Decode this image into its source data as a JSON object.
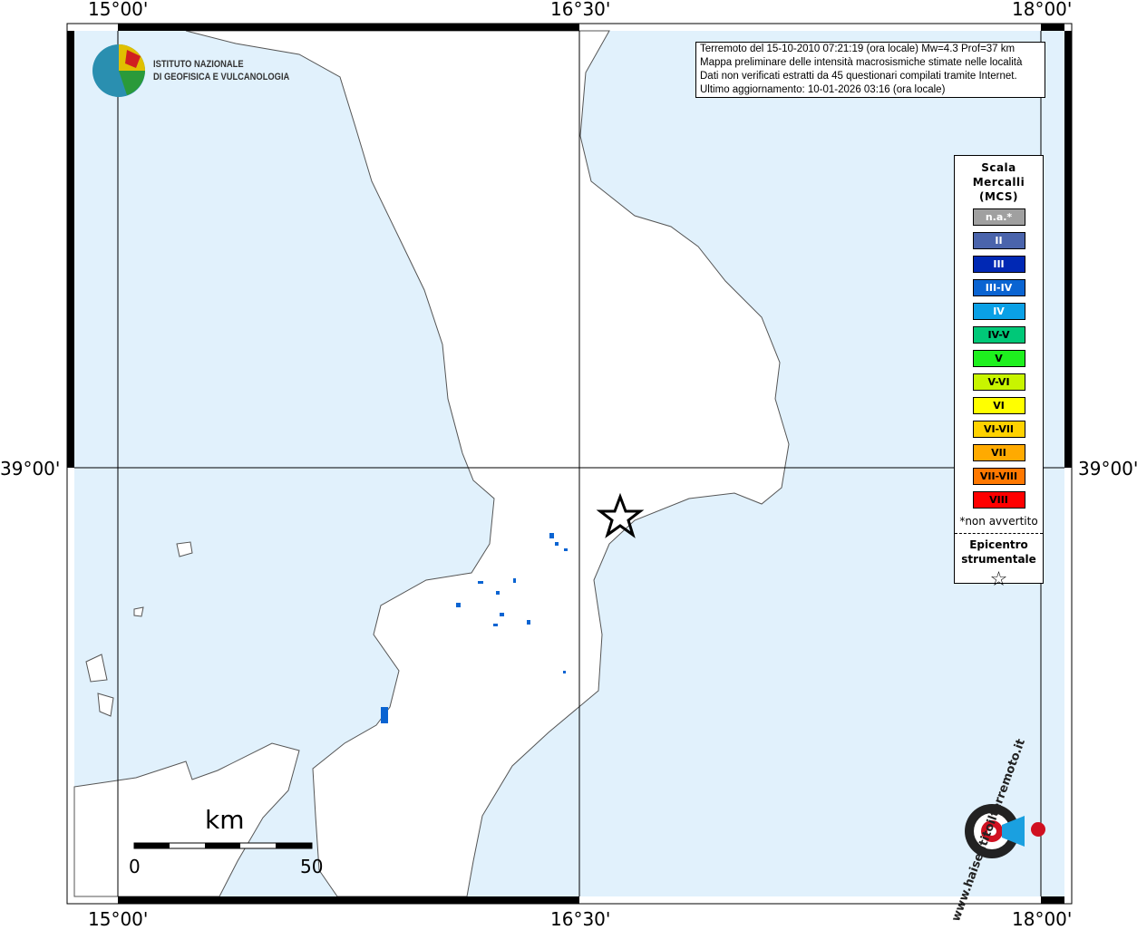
{
  "axes": {
    "lon_labels": [
      "15°00'",
      "16°30'",
      "18°00'"
    ],
    "lat_label": "39°00'"
  },
  "info_box": {
    "lines": [
      "Terremoto del 15-10-2010 07:21:19 (ora locale) Mw=4.3 Prof=37 km",
      "Mappa preliminare delle intensità macrosismiche stimate nelle località",
      "Dati non verificati estratti da 45 questionari compilati tramite Internet.",
      "Ultimo aggiornamento: 10-01-2026 03:16 (ora locale)"
    ]
  },
  "logo": {
    "line1": "ISTITUTO NAZIONALE",
    "line2": "DI GEOFISICA E VULCANOLOGIA"
  },
  "legend": {
    "title": [
      "Scala",
      "Mercalli",
      "(MCS)"
    ],
    "items": [
      {
        "label": "n.a.*",
        "color": "#a0a0a0",
        "text": "#ffffff"
      },
      {
        "label": "II",
        "color": "#4a64ac",
        "text": "#ffffff"
      },
      {
        "label": "III",
        "color": "#0028b4",
        "text": "#ffffff"
      },
      {
        "label": "III-IV",
        "color": "#0a64d2",
        "text": "#ffffff"
      },
      {
        "label": "IV",
        "color": "#0aa0e6",
        "text": "#ffffff"
      },
      {
        "label": "IV-V",
        "color": "#00c878",
        "text": "#000000"
      },
      {
        "label": "V",
        "color": "#1ef01e",
        "text": "#000000"
      },
      {
        "label": "V-VI",
        "color": "#c8f500",
        "text": "#000000"
      },
      {
        "label": "VI",
        "color": "#ffff00",
        "text": "#000000"
      },
      {
        "label": "VI-VII",
        "color": "#ffd200",
        "text": "#000000"
      },
      {
        "label": "VII",
        "color": "#ffaa00",
        "text": "#000000"
      },
      {
        "label": "VII-VIII",
        "color": "#ff7800",
        "text": "#000000"
      },
      {
        "label": "VIII",
        "color": "#ff0000",
        "text": "#000000"
      }
    ],
    "note": "*non avvertito",
    "epicenter_title": [
      "Epicentro",
      "strumentale"
    ],
    "epicenter_symbol": "☆"
  },
  "scale": {
    "unit": "km",
    "min": "0",
    "max": "50"
  },
  "haisentito": {
    "text": "www.haisentitoilterremoto.it"
  },
  "colors": {
    "sea": "#e1f1fc",
    "land": "#ffffff"
  }
}
